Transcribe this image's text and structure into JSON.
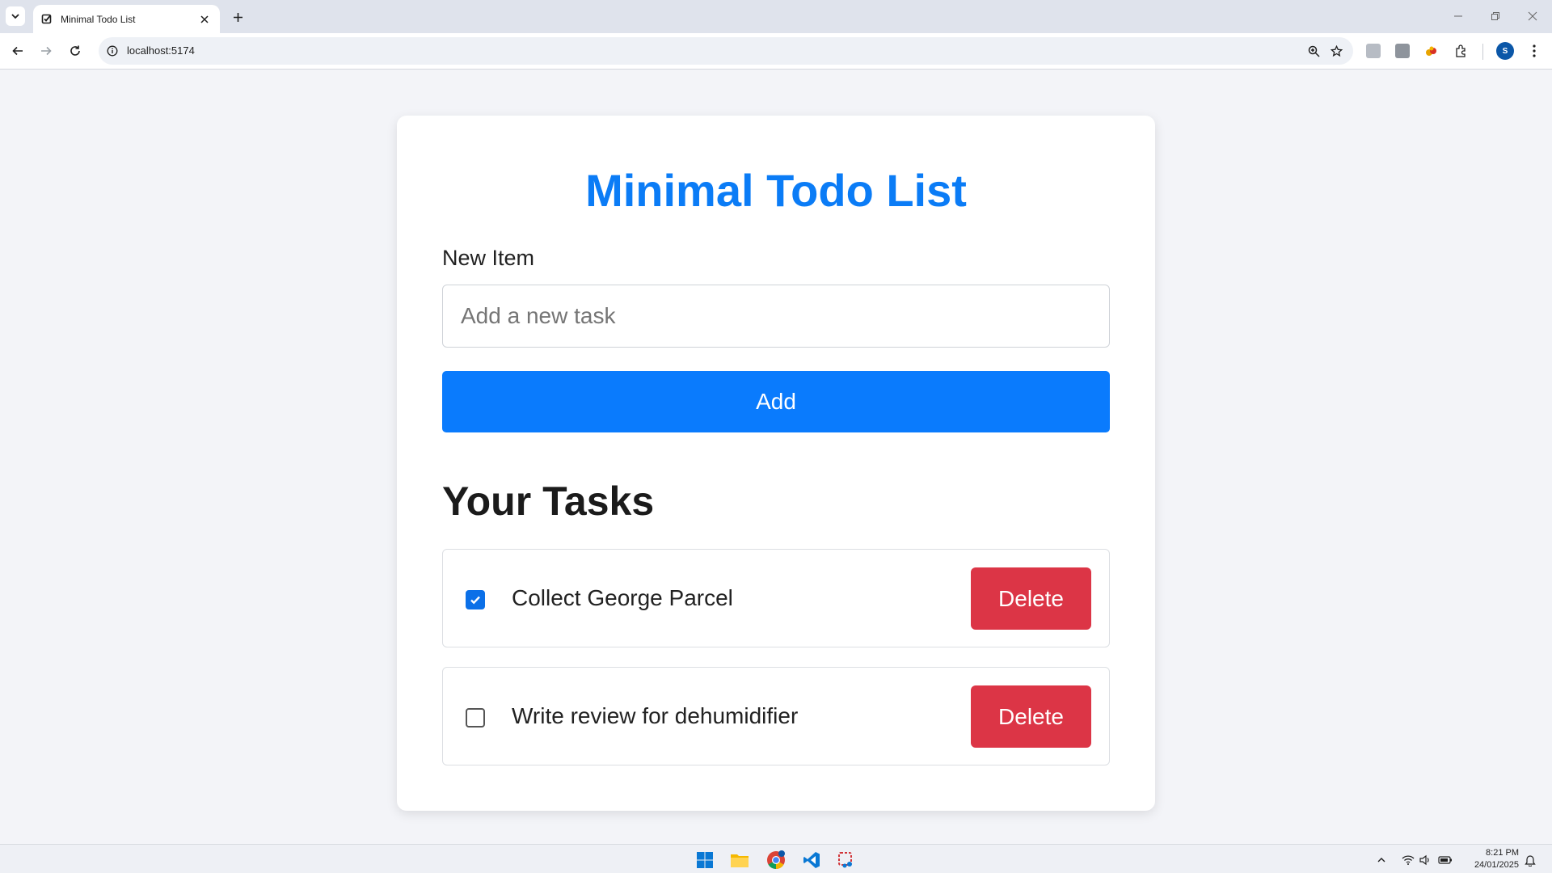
{
  "browser": {
    "tab_title": "Minimal Todo List",
    "url": "localhost:5174",
    "profile_initial": "S"
  },
  "app": {
    "title": "Minimal Todo List",
    "new_item_label": "New Item",
    "input": {
      "placeholder": "Add a new task",
      "value": ""
    },
    "add_label": "Add",
    "tasks_heading": "Your Tasks",
    "tasks": [
      {
        "text": "Collect George Parcel",
        "done": true,
        "delete_label": "Delete"
      },
      {
        "text": "Write review for dehumidifier",
        "done": false,
        "delete_label": "Delete"
      }
    ]
  },
  "taskbar": {
    "time": "8:21 PM",
    "date": "24/01/2025"
  },
  "colors": {
    "accent": "#0a7bfd",
    "danger": "#dc3546",
    "title": "#0b7cf6"
  }
}
